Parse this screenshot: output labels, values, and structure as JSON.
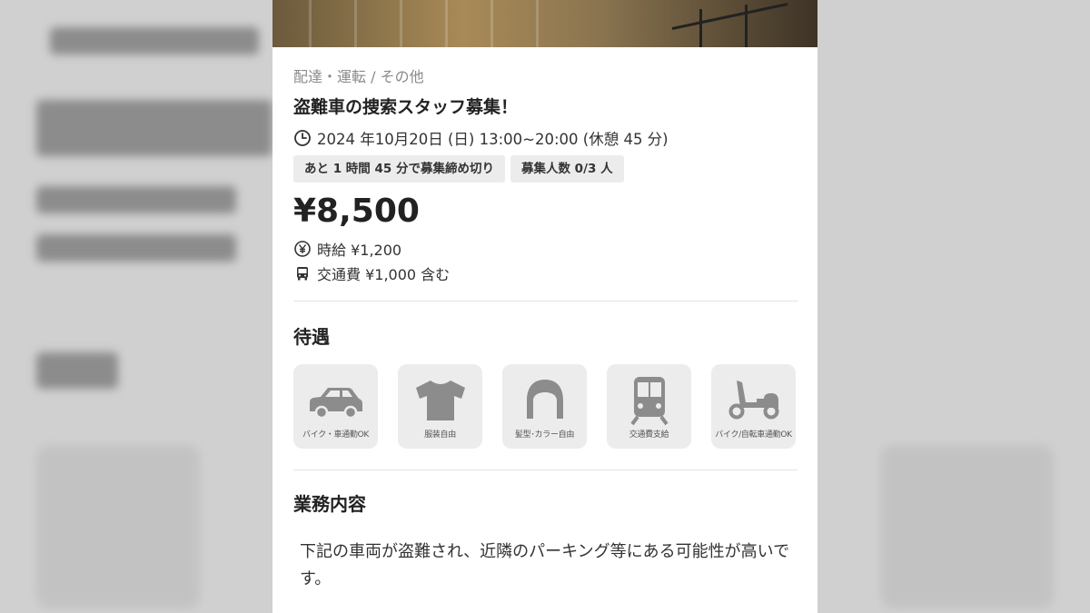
{
  "listing": {
    "category": "配達・運転 / その他",
    "title": "盗難車の捜索スタッフ募集！",
    "datetime": "2024 年10月20日 (日) 13:00~20:00 (休憩 45 分)",
    "tags": [
      "あと 1 時間 45 分で募集締め切り",
      "募集人数 0/3 人"
    ],
    "price": "¥8,500",
    "hourly_wage": "時給 ¥1,200",
    "transport_fee": "交通費 ¥1,000 含む"
  },
  "benefits_section": {
    "title": "待遇",
    "items": [
      {
        "label": "バイク・車通勤OK",
        "icon": "car-icon"
      },
      {
        "label": "服装自由",
        "icon": "tshirt-icon"
      },
      {
        "label": "髪型･カラー自由",
        "icon": "hair-icon"
      },
      {
        "label": "交通費支給",
        "icon": "train-icon"
      },
      {
        "label": "バイク/自転車通勤OK",
        "icon": "scooter-icon"
      }
    ]
  },
  "job_section": {
    "title": "業務内容",
    "description": "下記の車両が盗難され、近隣のパーキング等にある可能性が高いです。"
  },
  "colors": {
    "icon_gray": "#8c8c8c",
    "tag_bg": "#ececec",
    "category_text": "#8a8a8a"
  }
}
